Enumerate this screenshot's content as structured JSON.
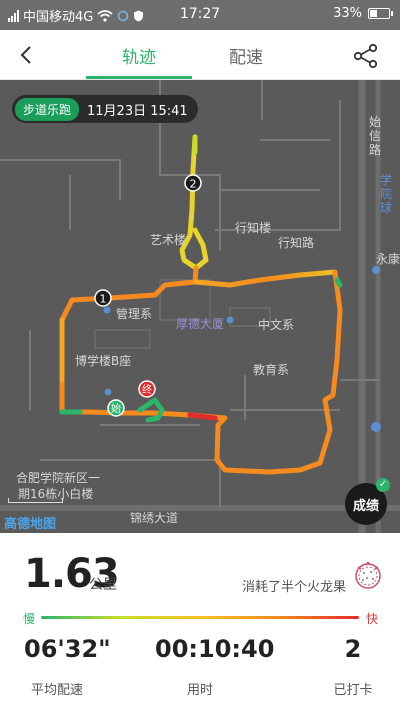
{
  "status_bar": {
    "carrier": "中国移动4G",
    "time": "17:27",
    "battery": "33%",
    "battery_level": 0.33
  },
  "header": {
    "tabs": [
      {
        "label": "轨迹",
        "active": true
      },
      {
        "label": "配速",
        "active": false
      }
    ],
    "accent_color": "#2cb56b"
  },
  "map": {
    "run_tag": "步道乐跑",
    "run_datetime": "11月23日 15:41",
    "labels": {
      "art": "艺术楼",
      "zhixing": "行知楼",
      "zhixing_road": "行知路",
      "management": "管理系",
      "houde": "厚德大厦",
      "chinese": "中文系",
      "boxue": "博学楼B座",
      "education": "教育系",
      "road_bottom": "锦绣大道",
      "campus": "合肥学院新区一期16栋小白楼",
      "campus_line1": "合肥学院新区一",
      "campus_line2": "期16栋小白楼",
      "right_col1": "始信路",
      "right_col2": "学院球",
      "yongkang": "永康",
      "boxue_short": "博学",
      "jiaoyu_short": "教育系"
    },
    "markers": {
      "start": "始",
      "end": "终",
      "checkpoint_1": "1",
      "checkpoint_2": "2"
    },
    "result_button": "成绩",
    "map_provider": "高德地图"
  },
  "stats": {
    "distance": "1.63",
    "distance_unit": "公里",
    "calorie_text": "消耗了半个火龙果",
    "speed_slow_label": "慢",
    "speed_fast_label": "快",
    "pace_value": "06'32\"",
    "pace_label": "平均配速",
    "time_value": "00:10:40",
    "time_label": "用时",
    "checkin_value": "2",
    "checkin_label": "已打卡"
  }
}
